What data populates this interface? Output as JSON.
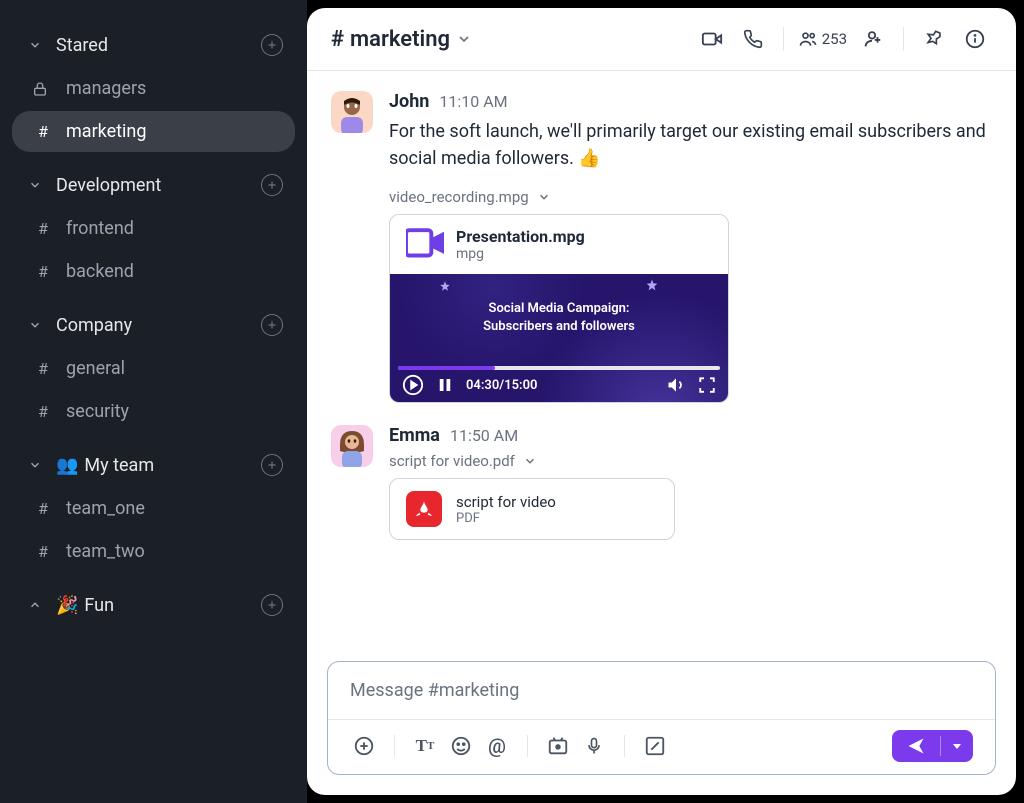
{
  "sidebar": {
    "sections": [
      {
        "label": "Stared",
        "expanded": true,
        "items": [
          {
            "icon": "lock",
            "name": "managers"
          },
          {
            "icon": "hash",
            "name": "marketing",
            "active": true
          }
        ]
      },
      {
        "label": "Development",
        "expanded": true,
        "items": [
          {
            "icon": "hash",
            "name": "frontend"
          },
          {
            "icon": "hash",
            "name": "backend"
          }
        ]
      },
      {
        "label": "Company",
        "expanded": true,
        "items": [
          {
            "icon": "hash",
            "name": "general"
          },
          {
            "icon": "hash",
            "name": "security"
          }
        ]
      },
      {
        "label": "My team",
        "emoji": "👥",
        "expanded": true,
        "items": [
          {
            "icon": "hash",
            "name": "team_one"
          },
          {
            "icon": "hash",
            "name": "team_two"
          }
        ]
      },
      {
        "label": "Fun",
        "emoji": "🎉",
        "expanded": false,
        "items": []
      }
    ]
  },
  "header": {
    "channel": "marketing",
    "memberCount": "253"
  },
  "messages": [
    {
      "avatarColor": "peach",
      "author": "John",
      "time": "11:10 AM",
      "text": "For the soft launch, we'll primarily target our existing email subscribers and social media followers. 👍",
      "attachment": {
        "label": "video_recording.mpg",
        "fileTitle": "Presentation.mpg",
        "fileExt": "mpg",
        "thumbTitle1": "Social Media Campaign:",
        "thumbTitle2": "Subscribers and followers",
        "playTime": "04:30/15:00"
      }
    },
    {
      "avatarColor": "pink",
      "author": "Emma",
      "time": "11:50 AM",
      "pdf": {
        "label": "script for video.pdf",
        "title": "script for video",
        "ext": "PDF"
      }
    }
  ],
  "composer": {
    "placeholder": "Message #marketing"
  }
}
